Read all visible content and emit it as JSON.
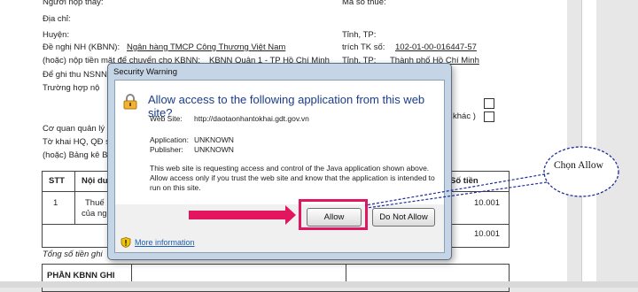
{
  "document": {
    "lines": [
      {
        "id": "nguoi-nop-thay",
        "text": "Người nộp thay:"
      },
      {
        "id": "ma-so-thue",
        "text": "Mã số thuế:"
      },
      {
        "id": "dia-chi",
        "text": "Địa chỉ:"
      },
      {
        "id": "huyen",
        "text": "Huyện:"
      },
      {
        "id": "tinh-tp",
        "text": "Tỉnh, TP:"
      },
      {
        "id": "de-nghi-nh",
        "text": "Đề nghị NH (KBNN):"
      },
      {
        "id": "ngan-hang",
        "text": "Ngân hàng TMCP Công Thương Việt Nam"
      },
      {
        "id": "trich-tk-so",
        "text": "trích TK số:"
      },
      {
        "id": "tk-number",
        "text": "102-01-00-016447-57"
      },
      {
        "id": "hoac-nop-tien",
        "text": "(hoặc) nộp tiền mặt để chuyển cho KBNN:"
      },
      {
        "id": "kbnn-value",
        "text": "KBNN Quận 1 - TP Hồ Chí Minh"
      },
      {
        "id": "tinh-tp-2",
        "text": "Tỉnh, TP:"
      },
      {
        "id": "tinh-value",
        "text": "Thành phố Hồ Chí Minh"
      },
      {
        "id": "de-ghi-thu",
        "text": "Để ghi thu NSNN"
      },
      {
        "id": "truong-hop",
        "text": "Trường hợp nộ"
      },
      {
        "id": "khac",
        "text": "khác )"
      },
      {
        "id": "co-quan",
        "text": "Cơ quan quản lý"
      },
      {
        "id": "to-khai",
        "text": "Tờ khai HQ, QĐ s"
      },
      {
        "id": "bang-ke",
        "text": "(hoặc) Bảng kê B"
      },
      {
        "id": "tong-so-tien",
        "text": "Tổng số tiền ghi"
      }
    ],
    "table": {
      "stt": "STT",
      "noi_dung": "Nội du",
      "so_tien": "Số tiền",
      "row1_stt": "1",
      "row1_desc1": "Thuế",
      "row1_desc2": "của ng",
      "row1_amount": "10.001",
      "total_amount": "10.001"
    },
    "phan_kbnn": "PHẦN KBNN GHI"
  },
  "dialog": {
    "title": "Security Warning",
    "heading": "Allow access to the following application from this web site?",
    "web_site_label": "Web Site:",
    "web_site_value": "http://daotaonhantokhai.gdt.gov.vn",
    "application_label": "Application:",
    "application_value": "UNKNOWN",
    "publisher_label": "Publisher:",
    "publisher_value": "UNKNOWN",
    "message": "This web site is requesting access and control of the Java application shown above. Allow access only if you trust the web site and know that the application is intended to run on this site.",
    "allow_label": "Allow",
    "deny_label": "Do Not Allow",
    "more_info": "More information"
  },
  "annotation": {
    "callout_text": "Chọn Allow",
    "arrow_color": "#e4155f",
    "callout_color": "#1f2d9c"
  }
}
